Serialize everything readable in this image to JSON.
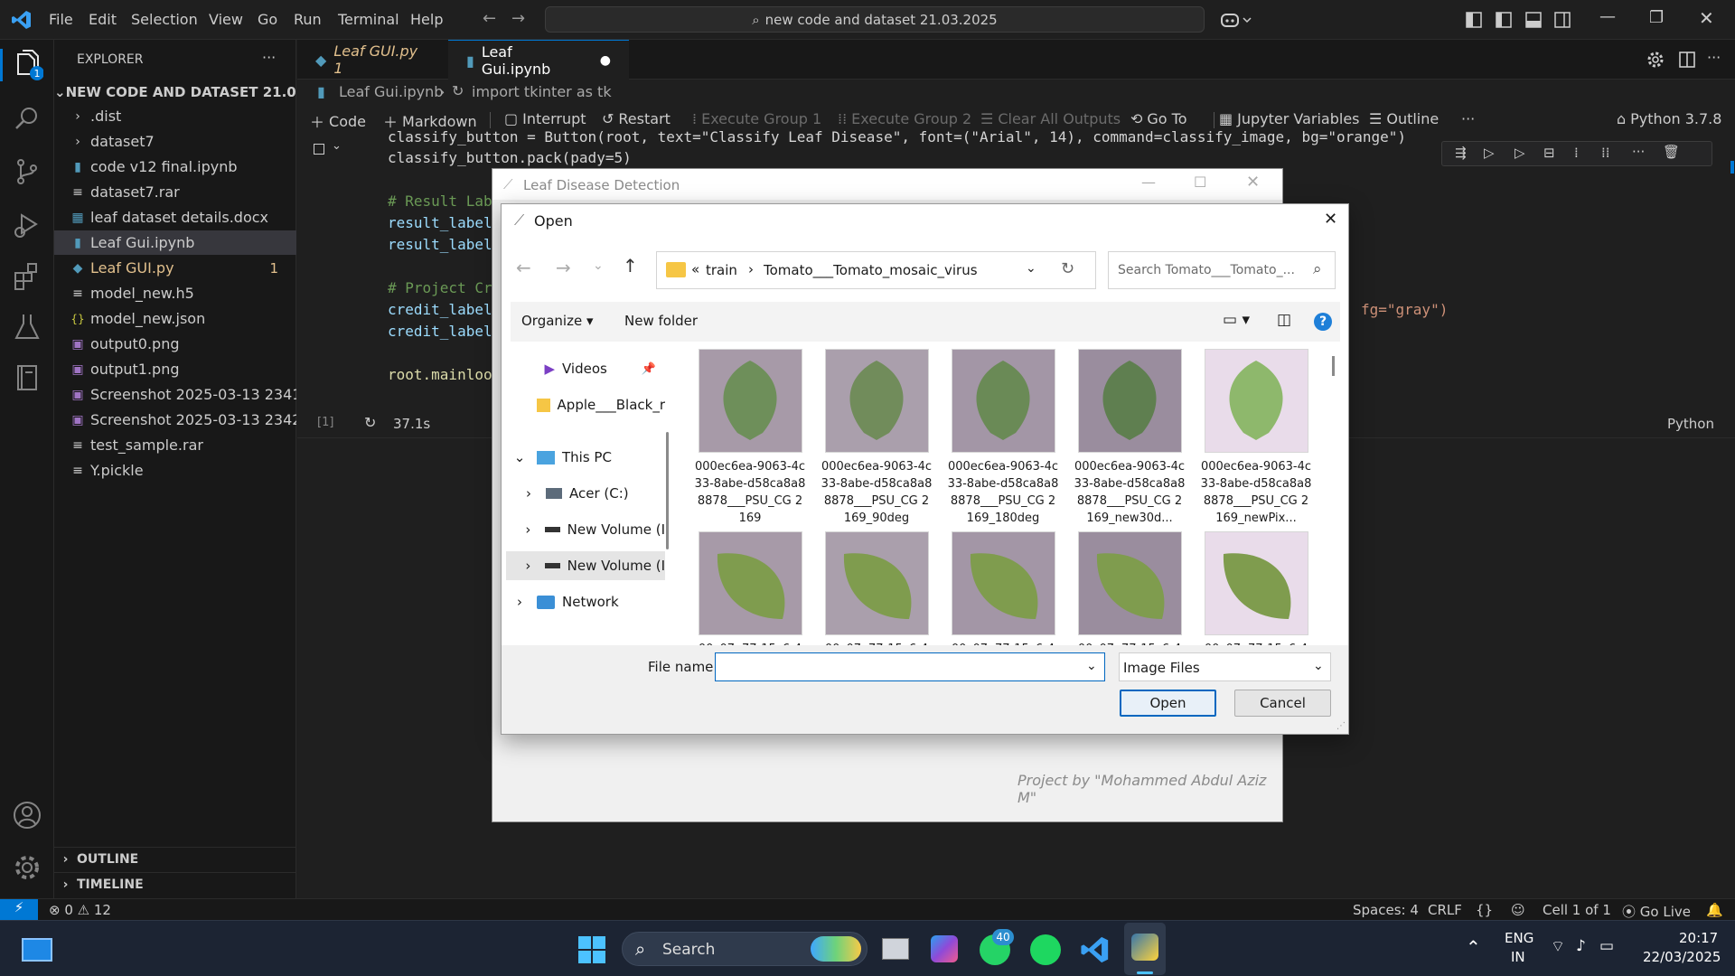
{
  "menu": [
    "File",
    "Edit",
    "Selection",
    "View",
    "Go",
    "Run",
    "Terminal",
    "Help"
  ],
  "search": {
    "text": "new code and dataset 21.03.2025"
  },
  "explorer": {
    "title": "EXPLORER",
    "folder": "NEW CODE AND DATASET 21.03.20...",
    "items": [
      {
        "label": ".dist",
        "kind": "folder"
      },
      {
        "label": "dataset7",
        "kind": "folder"
      },
      {
        "label": "code v12 final.ipynb",
        "kind": "notebook"
      },
      {
        "label": "dataset7.rar",
        "kind": "file"
      },
      {
        "label": "leaf dataset details.docx",
        "kind": "docx"
      },
      {
        "label": "Leaf Gui.ipynb",
        "kind": "notebook"
      },
      {
        "label": "Leaf GUI.py",
        "kind": "python",
        "badge": "1"
      },
      {
        "label": "model_new.h5",
        "kind": "file"
      },
      {
        "label": "model_new.json",
        "kind": "json"
      },
      {
        "label": "output0.png",
        "kind": "image"
      },
      {
        "label": "output1.png",
        "kind": "image"
      },
      {
        "label": "Screenshot 2025-03-13 2341...",
        "kind": "image"
      },
      {
        "label": "Screenshot 2025-03-13 2342...",
        "kind": "image"
      },
      {
        "label": "test_sample.rar",
        "kind": "file"
      },
      {
        "label": "Y.pickle",
        "kind": "file"
      }
    ],
    "outline": "OUTLINE",
    "timeline": "TIMELINE"
  },
  "tabs": [
    {
      "label": "Leaf GUI.py 1"
    },
    {
      "label": "Leaf Gui.ipynb"
    }
  ],
  "breadcrumbs": {
    "file": "Leaf Gui.ipynb",
    "symbol": "import tkinter as tk"
  },
  "toolbar": {
    "code": "Code",
    "markdown": "Markdown",
    "interrupt": "Interrupt",
    "restart": "Restart",
    "exec1": "Execute Group 1",
    "exec2": "Execute Group 2",
    "clear": "Clear All Outputs",
    "goto": "Go To",
    "vars": "Jupyter Variables",
    "outline": "Outline",
    "more": "···",
    "kernel": "Python 3.7.8"
  },
  "code": {
    "line1": "classify_button = Button(root, text=\"Classify Leaf Disease\", font=(\"Arial\", 14), command=classify_image, bg=\"orange\")",
    "line2": "classify_button.pack(pady=5)",
    "line3": "# Result Lab",
    "line4": "result_label",
    "line5": "result_label",
    "line6": "# Project Cr",
    "line7": "credit_label",
    "line8": "credit_label",
    "line7_tail": "fg=\"gray\")",
    "line9": "root.mainloo",
    "exec_count": "[1]",
    "duration": "37.1s",
    "lang": "Python"
  },
  "status": {
    "errors": "0",
    "warnings": "12",
    "spaces": "Spaces: 4",
    "eol": "CRLF",
    "braces": "{}",
    "cell": "Cell 1 of 1",
    "golive": "Go Live"
  },
  "taskbar": {
    "search": "Search",
    "badge": "40",
    "lang1": "ENG",
    "lang2": "IN",
    "time": "20:17",
    "date": "22/03/2025"
  },
  "tkwin": {
    "title": "Leaf Disease Detection",
    "credit": "Project by \"Mohammed Abdul Aziz M\""
  },
  "dialog": {
    "title": "Open",
    "path_prefix": "«",
    "path1": "train",
    "path2": "Tomato___Tomato_mosaic_virus",
    "search_placeholder": "Search Tomato___Tomato_...",
    "organize": "Organize",
    "new_folder": "New folder",
    "nav": [
      {
        "label": "Videos"
      },
      {
        "label": "Apple___Black_r"
      },
      {
        "label": "This PC"
      },
      {
        "label": "Acer (C:)"
      },
      {
        "label": "New Volume (I"
      },
      {
        "label": "New Volume (I"
      },
      {
        "label": "Network"
      }
    ],
    "files": [
      "000ec6ea-9063-4c33-8abe-d58ca8a88878___PSU_CG 2169",
      "000ec6ea-9063-4c33-8abe-d58ca8a88878___PSU_CG 2169_90deg",
      "000ec6ea-9063-4c33-8abe-d58ca8a88878___PSU_CG 2169_180deg",
      "000ec6ea-9063-4c33-8abe-d58ca8a88878___PSU_CG 2169_new30d...",
      "000ec6ea-9063-4c33-8abe-d58ca8a88878___PSU_CG 2169_newPix..."
    ],
    "row2_cap": "00c07a77-15c6-4",
    "filename_label": "File name:",
    "filename_value": "",
    "filetype": "Image Files",
    "open": "Open",
    "cancel": "Cancel"
  }
}
